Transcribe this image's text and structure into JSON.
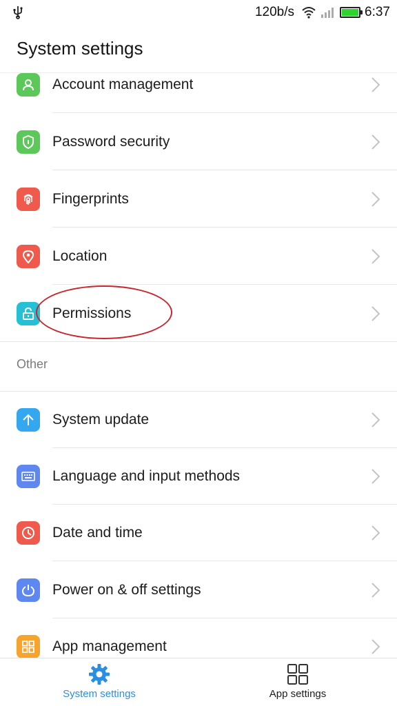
{
  "status_bar": {
    "speed": "120b/s",
    "time": "6:37",
    "battery_color": "#2ed32e",
    "icons": [
      "usb-icon",
      "wifi-icon",
      "signal-icon",
      "battery-icon"
    ]
  },
  "header": {
    "title": "System settings"
  },
  "section_top": {
    "items": [
      {
        "label": "Account management",
        "icon": "person-icon",
        "color": "#5cc85a"
      },
      {
        "label": "Password security",
        "icon": "shield-icon",
        "color": "#5cc85a"
      },
      {
        "label": "Fingerprints",
        "icon": "fingerprint-icon",
        "color": "#ef5a4c"
      },
      {
        "label": "Location",
        "icon": "location-pin-icon",
        "color": "#ef5a4c"
      },
      {
        "label": "Permissions",
        "icon": "lock-icon",
        "color": "#25c0d3"
      }
    ]
  },
  "section_other": {
    "title": "Other",
    "items": [
      {
        "label": "System update",
        "icon": "arrow-up-icon",
        "color": "#33a8f0"
      },
      {
        "label": "Language and input methods",
        "icon": "keyboard-icon",
        "color": "#5e88f0"
      },
      {
        "label": "Date and time",
        "icon": "clock-icon",
        "color": "#ef5a4c"
      },
      {
        "label": "Power on & off settings",
        "icon": "power-icon",
        "color": "#5e88f0"
      },
      {
        "label": "App management",
        "icon": "grid-icon",
        "color": "#f6a42c"
      }
    ]
  },
  "bottom_nav": {
    "system_settings": "System settings",
    "app_settings": "App settings",
    "active_color": "#2a8fe0"
  }
}
